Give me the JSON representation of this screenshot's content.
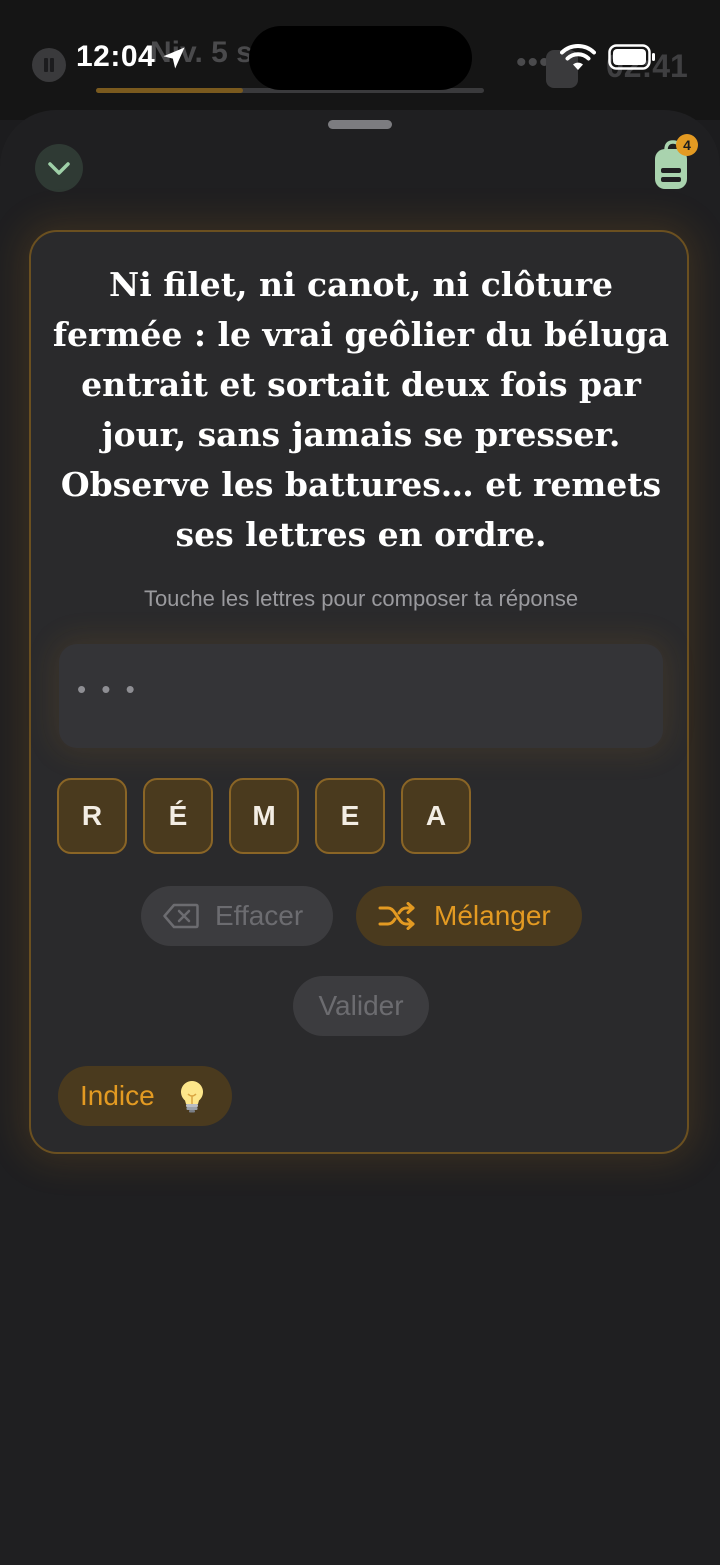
{
  "status_bar": {
    "time": "12:04"
  },
  "background": {
    "level_text": "Niv. 5 su",
    "timer": "02:41",
    "progress": 0.38
  },
  "header": {
    "inventory_count": "4"
  },
  "puzzle": {
    "riddle": "Ni filet, ni canot, ni clôture fermée : le vrai geôlier du béluga entrait et sortait deux fois par jour, sans jamais se presser. Observe les battures… et remets ses lettres en ordre.",
    "instruction": "Touche les lettres pour composer ta réponse",
    "answer_placeholder": "• • •",
    "letters": [
      "R",
      "É",
      "M",
      "E",
      "A"
    ]
  },
  "actions": {
    "erase_label": "Effacer",
    "shuffle_label": "Mélanger",
    "validate_label": "Valider",
    "hint_label": "Indice"
  },
  "colors": {
    "accent": "#e39a22",
    "tile_bg": "#4a3a1e",
    "card_border": "#6b5020",
    "background": "#1c1c1e"
  },
  "icons": {
    "location": "location-arrow-icon",
    "wifi": "wifi-icon",
    "battery": "battery-icon",
    "collapse": "chevron-down-icon",
    "inventory": "backpack-icon",
    "erase": "backspace-icon",
    "shuffle": "shuffle-icon",
    "hint": "lightbulb-icon"
  }
}
